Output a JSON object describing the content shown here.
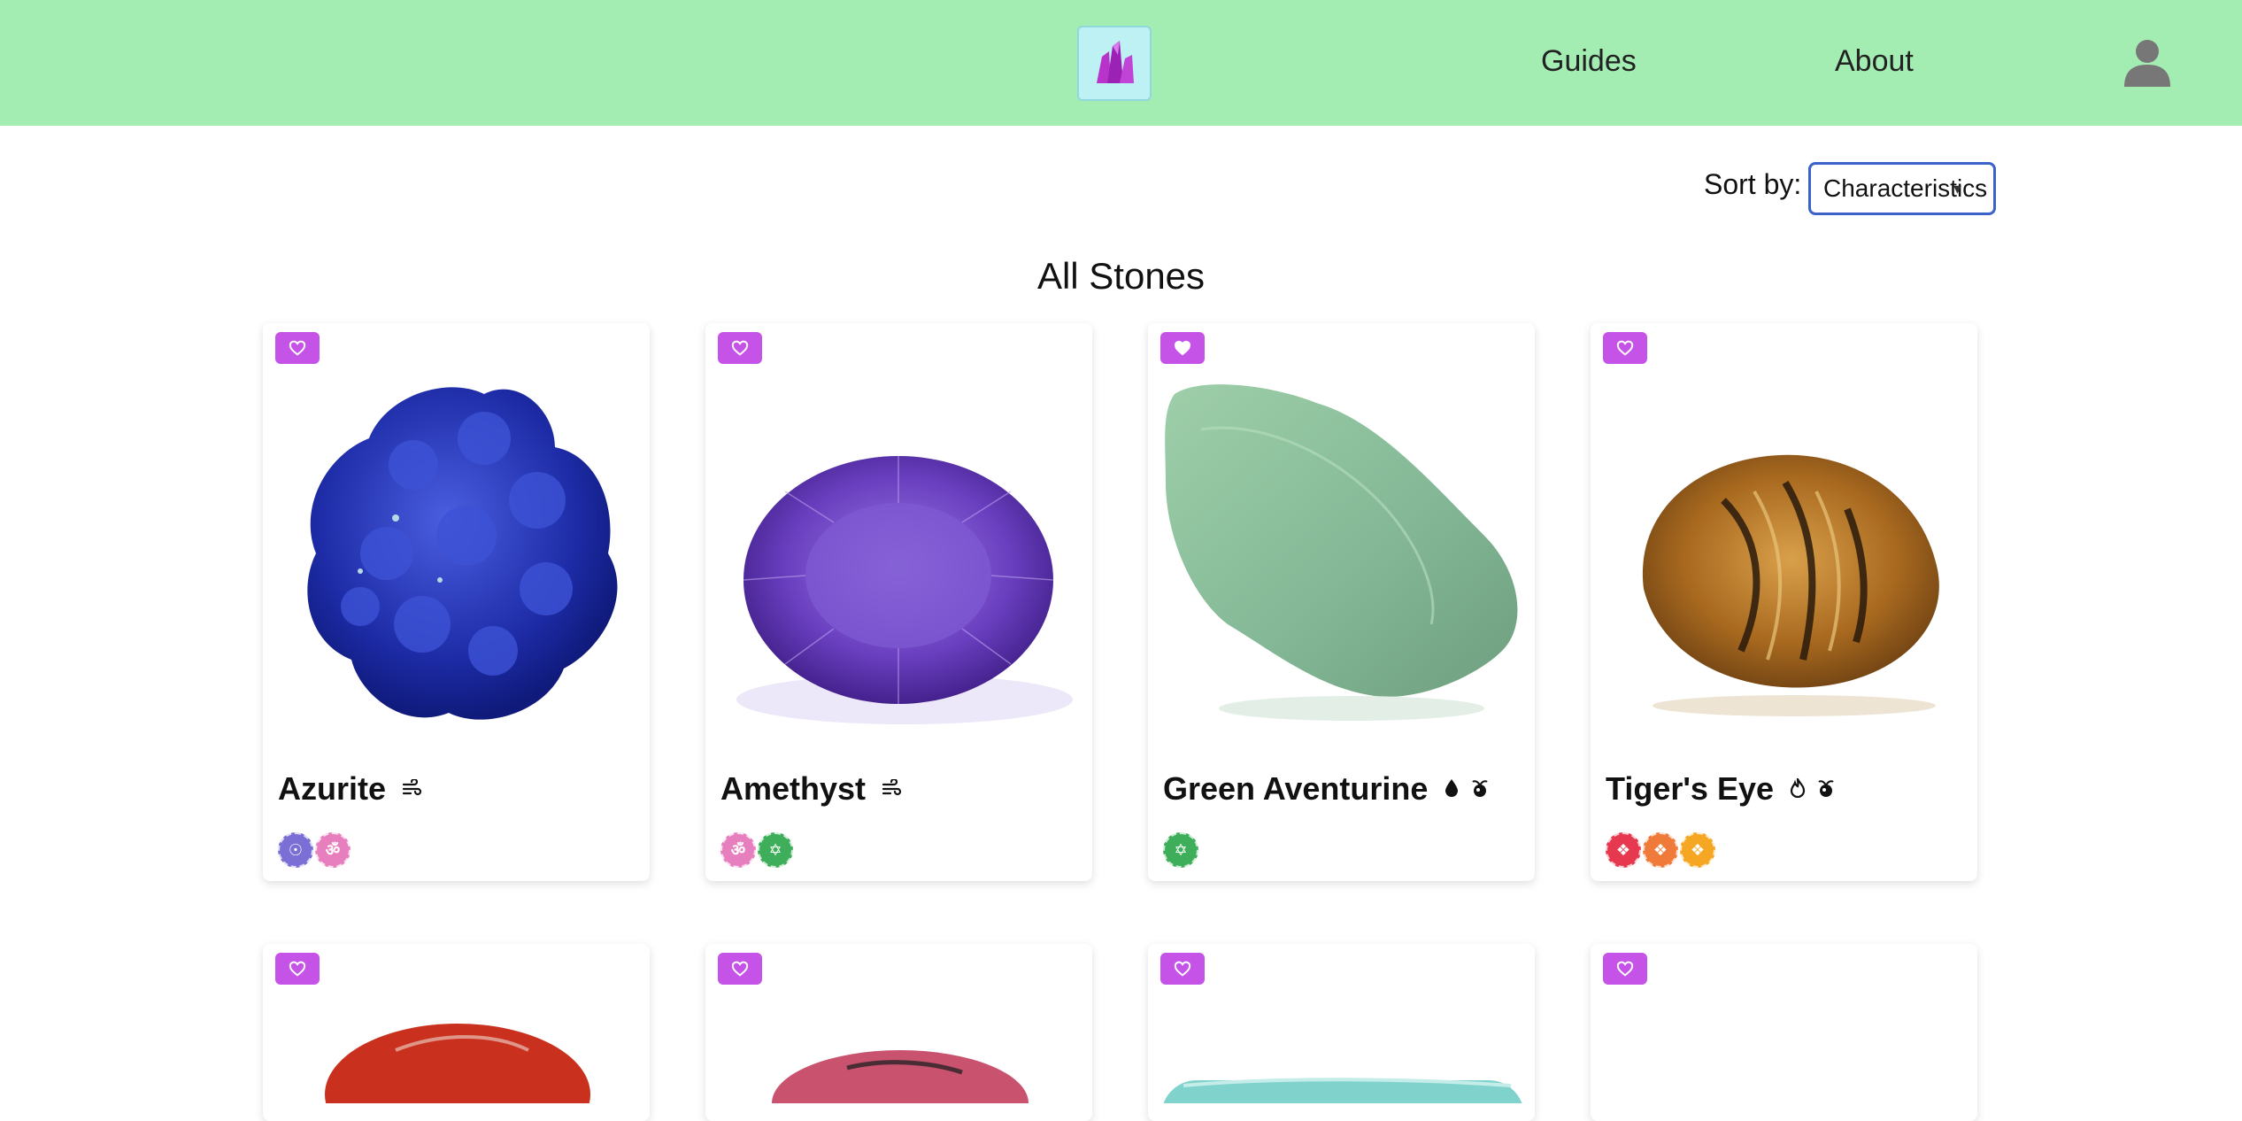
{
  "nav": {
    "guides": "Guides",
    "about": "About"
  },
  "sort": {
    "label": "Sort by:",
    "selected": "Characteristics"
  },
  "page_title": "All Stones",
  "stones": [
    {
      "name": "Azurite",
      "element_icons": [
        "air-icon"
      ],
      "favorited": false,
      "chakras": [
        {
          "color": "#7b6fd6",
          "glyph": "☉"
        },
        {
          "color": "#e77fbe",
          "glyph": "ॐ"
        }
      ]
    },
    {
      "name": "Amethyst",
      "element_icons": [
        "air-icon"
      ],
      "favorited": false,
      "chakras": [
        {
          "color": "#e77fbe",
          "glyph": "ॐ"
        },
        {
          "color": "#3fae5a",
          "glyph": "✡"
        }
      ]
    },
    {
      "name": "Green Aventurine",
      "element_icons": [
        "water-icon",
        "earth-icon"
      ],
      "favorited": true,
      "chakras": [
        {
          "color": "#3fae5a",
          "glyph": "✡"
        }
      ]
    },
    {
      "name": "Tiger's Eye",
      "element_icons": [
        "fire-icon",
        "earth-icon"
      ],
      "favorited": false,
      "chakras": [
        {
          "color": "#e6394f",
          "glyph": "❖"
        },
        {
          "color": "#f07a3a",
          "glyph": "❖"
        },
        {
          "color": "#f5a623",
          "glyph": "❖"
        }
      ]
    }
  ],
  "colors": {
    "header_bg": "#a3ecb2",
    "accent": "#c653e8",
    "logo_bg": "#bdf1f3"
  }
}
